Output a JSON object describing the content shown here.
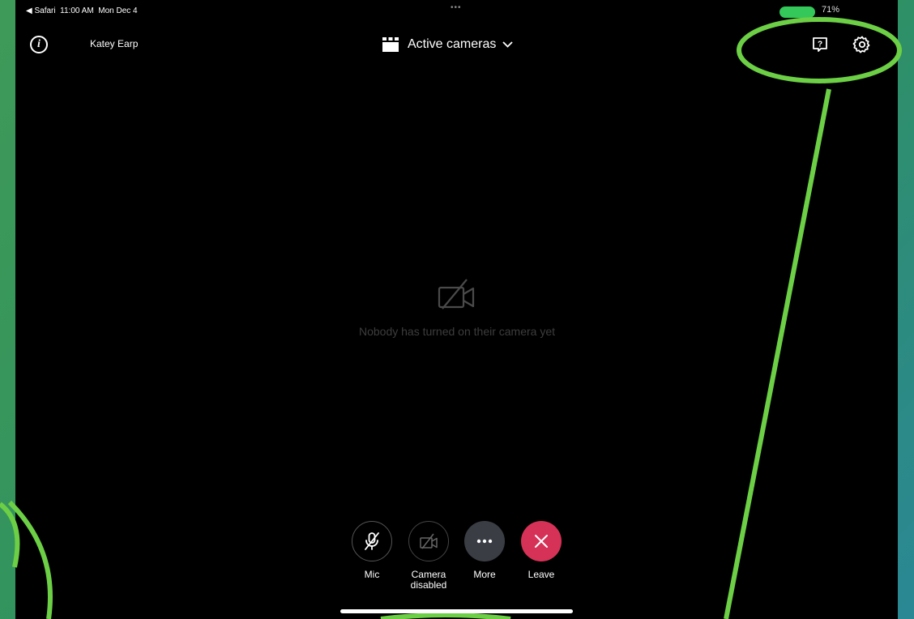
{
  "status_bar": {
    "back_app": "◀ Safari",
    "time": "11:00 AM",
    "date": "Mon Dec 4",
    "multitask_dots": "•••",
    "battery": "71%"
  },
  "header": {
    "user_name": "Katey Earp",
    "view_selector": "Active cameras"
  },
  "main": {
    "empty_message": "Nobody has turned on their camera yet"
  },
  "controls": [
    {
      "label": "Mic"
    },
    {
      "label": "Camera\ndisabled"
    },
    {
      "label": "More"
    },
    {
      "label": "Leave"
    }
  ],
  "colors": {
    "annotation": "#6ccf45",
    "leave": "#d63257",
    "more": "#3a3d44"
  },
  "icons": [
    "info-icon",
    "grid-icon",
    "chevron-down-icon",
    "help-icon",
    "gear-icon",
    "camera-off-icon",
    "mic-off-icon",
    "camera-disabled-icon",
    "more-icon",
    "close-icon"
  ]
}
